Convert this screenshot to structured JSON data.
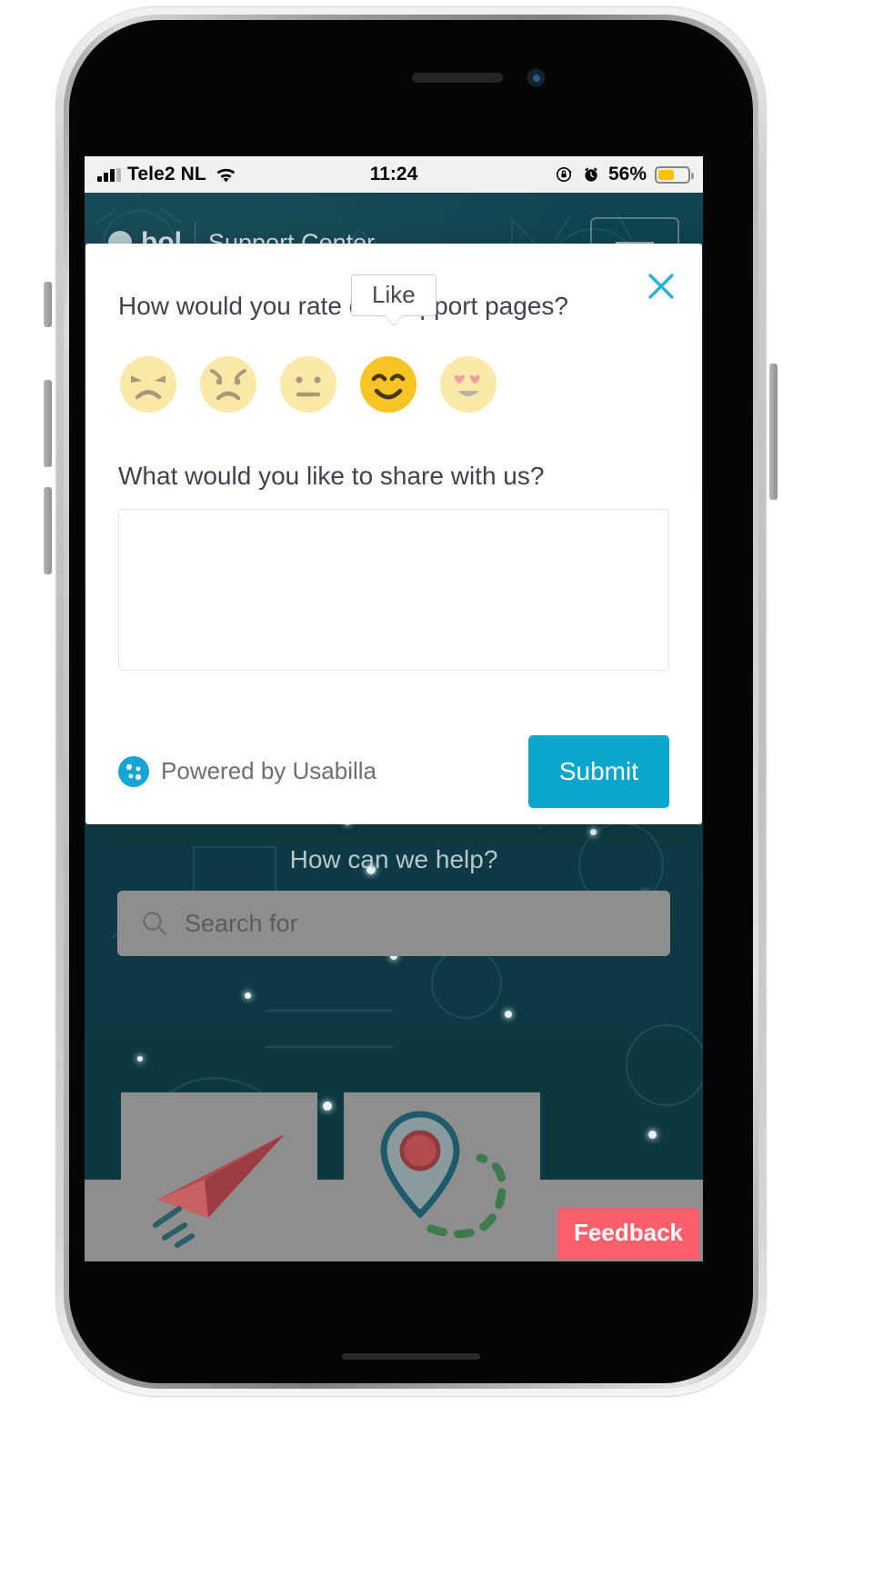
{
  "status_bar": {
    "carrier": "Tele2 NL",
    "signal_icon": "cellular-signal-icon",
    "wifi_icon": "wifi-icon",
    "time": "11:24",
    "rotation_lock_icon": "rotation-lock-icon",
    "alarm_icon": "alarm-clock-icon",
    "battery_percent": "56%",
    "battery_level": 56,
    "battery_color": "#fcc200"
  },
  "page": {
    "nav": {
      "logo_label": "bol",
      "title": "Support Center",
      "menu_icon": "hamburger-menu-icon"
    },
    "heading": "How can we help?",
    "search": {
      "placeholder": "Search for",
      "icon": "search-icon",
      "value": ""
    },
    "cards": [
      {
        "icon": "paper-plane-icon"
      },
      {
        "icon": "map-pin-route-icon"
      }
    ],
    "feedback_tab": "Feedback",
    "background_color": "#0d3d46"
  },
  "modal": {
    "close_icon": "close-icon",
    "close_color": "#29b3d8",
    "question_1": "How would you rate our support pages?",
    "tooltip": "Like",
    "ratings": [
      {
        "name": "angry",
        "label": "Dislike a lot",
        "selected": false,
        "face_color": "#fae8a8"
      },
      {
        "name": "sad",
        "label": "Dislike",
        "selected": false,
        "face_color": "#fae8a8"
      },
      {
        "name": "neutral",
        "label": "Neutral",
        "selected": false,
        "face_color": "#fbe9a9"
      },
      {
        "name": "happy",
        "label": "Like",
        "selected": true,
        "face_color": "#f7c325"
      },
      {
        "name": "love",
        "label": "Like a lot",
        "selected": false,
        "face_color": "#fbe9a9"
      }
    ],
    "question_2": "What would you like to share with us?",
    "comment": {
      "value": "",
      "placeholder": ""
    },
    "powered_by": "Powered by Usabilla",
    "powered_by_icon": "usabilla-logo-icon",
    "submit_label": "Submit",
    "submit_color": "#0ba6cd"
  }
}
